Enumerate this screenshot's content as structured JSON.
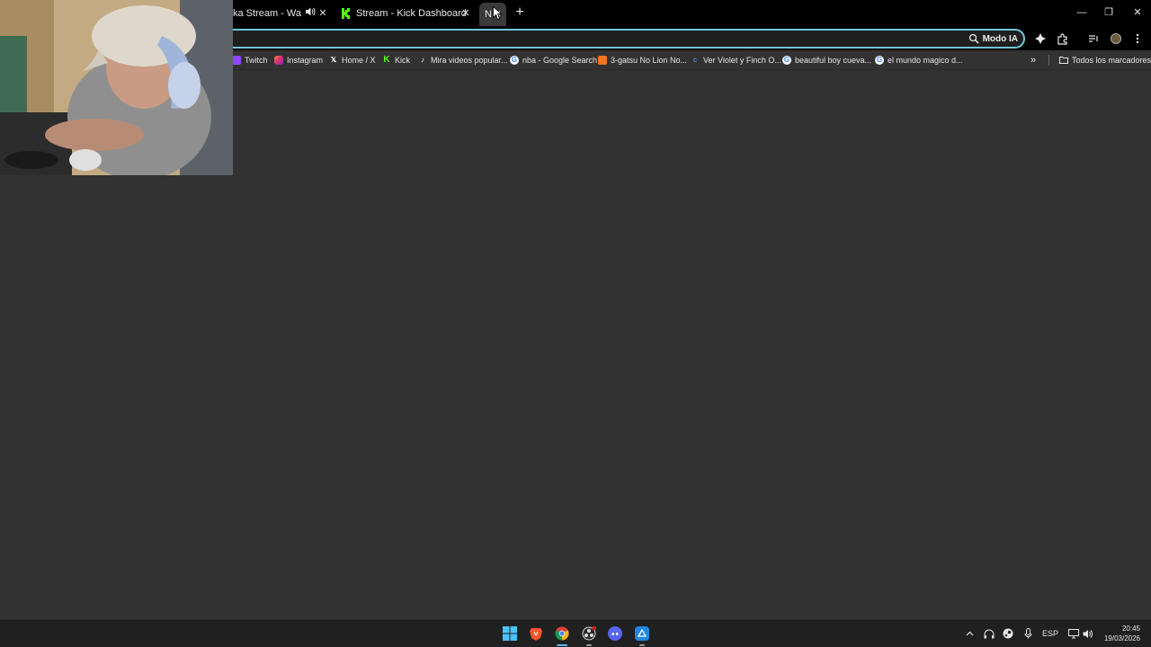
{
  "browser": {
    "tabs": [
      {
        "title": "ka Stream - Watch Li",
        "close": "✕",
        "audio": true
      },
      {
        "title": "Stream - Kick Dashboard",
        "close": "✕"
      },
      {
        "title": "N",
        "close": "✕",
        "active": true
      }
    ],
    "new_tab": "+",
    "window_controls": {
      "minimize": "—",
      "restore": "❐",
      "close": "✕"
    }
  },
  "omnibox": {
    "value": "",
    "placeholder": "",
    "ai_mode_label": "Modo IA"
  },
  "bookmarks": [
    {
      "label": "Twitch",
      "icon": "twitch-icon"
    },
    {
      "label": "Instagram",
      "icon": "instagram-icon"
    },
    {
      "label": "Home / X",
      "icon": "x-icon"
    },
    {
      "label": "Kick",
      "icon": "kick-icon"
    },
    {
      "label": "Mira videos popular...",
      "icon": "tiktok-icon"
    },
    {
      "label": "nba - Google Search",
      "icon": "google-icon"
    },
    {
      "label": "3-gatsu No Lion No...",
      "icon": "crunchyroll-icon"
    },
    {
      "label": "Ver Violet y Finch O...",
      "icon": "site-icon"
    },
    {
      "label": "beautiful boy cueva...",
      "icon": "google-icon"
    },
    {
      "label": "el mundo magico d...",
      "icon": "google-icon"
    }
  ],
  "bookmarks_overflow": "»",
  "all_bookmarks_label": "Todos los marcadores",
  "taskbar": {
    "language": "ESP",
    "time": "20:45",
    "date": "19/03/2026"
  },
  "colors": {
    "accent": "#6fc7d8",
    "kick_green": "#53fc18",
    "page_bg": "#323232",
    "taskbar_bg": "#202020"
  }
}
